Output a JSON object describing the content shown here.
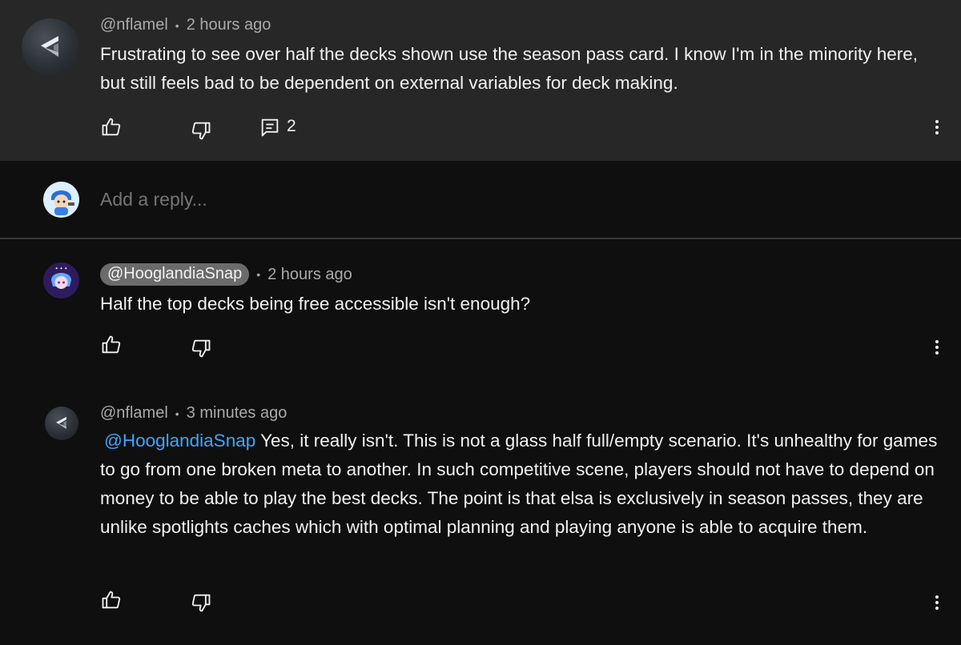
{
  "comments": [
    {
      "author": "@nflamel",
      "time": "2 hours ago",
      "text": "Frustrating to see over half the decks shown use the season pass card. I know I'm in the minority here, but still feels bad to be dependent on external variables for deck making.",
      "reply_count": "2"
    },
    {
      "author": "@HooglandiaSnap",
      "time": "2 hours ago",
      "text": "Half the top decks being free accessible isn't enough?"
    },
    {
      "author": "@nflamel",
      "time": "3 minutes ago",
      "mention": "@HooglandiaSnap",
      "text": " Yes, it really isn't. This is not a glass half full/empty scenario. It's unhealthy for games to go from one broken meta to another. In such competitive scene, players should not have to depend on money to be able to play the best decks. The point is that elsa is exclusively in season passes, they are unlike spotlights caches which with optimal planning and playing anyone is able to acquire them."
    }
  ],
  "reply_box": {
    "placeholder": "Add a reply..."
  },
  "icons": {
    "like": "thumbs-up-icon",
    "dislike": "thumbs-down-icon",
    "replies": "comment-icon",
    "more": "more-vert-icon"
  },
  "colors": {
    "highlight_bg": "#272727",
    "page_bg": "#0f0f0f",
    "mention": "#3ea6ff",
    "chip_bg": "#6b6b6b"
  }
}
